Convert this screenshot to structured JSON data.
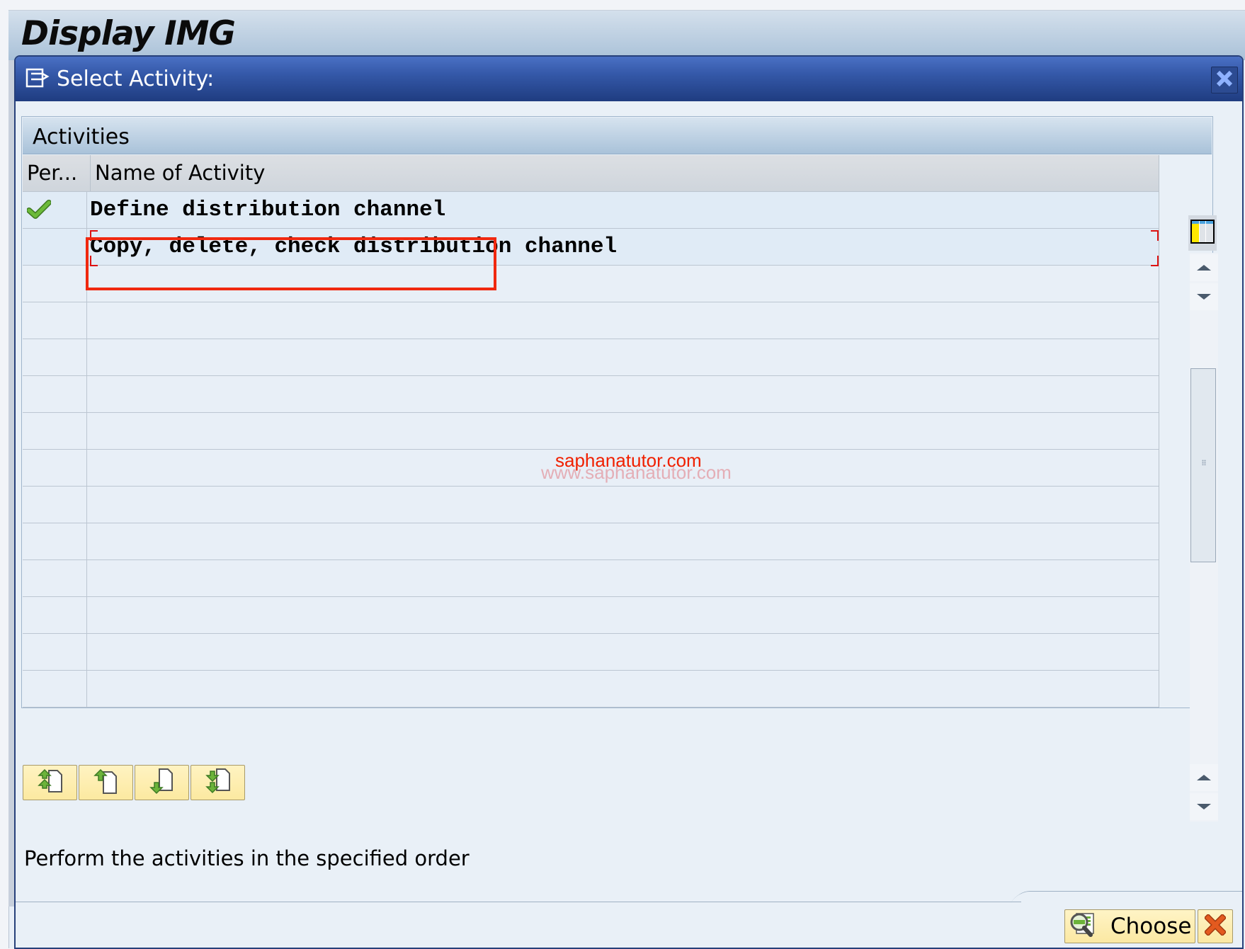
{
  "background_window": {
    "title": "Display IMG"
  },
  "dialog": {
    "title": "Select Activity:",
    "title_icon": "select-list-icon",
    "close_icon": "close-icon"
  },
  "panel": {
    "title": "Activities",
    "columns": [
      {
        "key": "performed",
        "label": "Per..."
      },
      {
        "key": "name",
        "label": "Name of Activity"
      }
    ],
    "rows": [
      {
        "performed": true,
        "performed_icon": "checkmark-icon",
        "name": "Define distribution channel",
        "focused": true,
        "annotated": true
      },
      {
        "performed": false,
        "name": "Copy, delete, check distribution channel",
        "focused": false,
        "annotated": false
      }
    ],
    "empty_rows": 12,
    "column_config_icon": "column-layout-icon"
  },
  "watermark": {
    "primary": "saphanatutor.com",
    "secondary": "www.saphanatutor.com"
  },
  "order_buttons": [
    {
      "name": "move-to-top-button",
      "icon": "move-top-icon"
    },
    {
      "name": "move-up-button",
      "icon": "move-up-icon"
    },
    {
      "name": "move-down-button",
      "icon": "move-down-icon"
    },
    {
      "name": "move-to-bottom-button",
      "icon": "move-bottom-icon"
    }
  ],
  "hint": "Perform the activities in the specified order",
  "footer": {
    "choose_label": "Choose",
    "choose_icon": "choose-magnifier-icon",
    "cancel_icon": "cancel-x-icon"
  },
  "colors": {
    "title_bar": "#3458a8",
    "annotation": "#f0280f",
    "button_bg": "#fdeeb2",
    "check": "#5aa332"
  }
}
